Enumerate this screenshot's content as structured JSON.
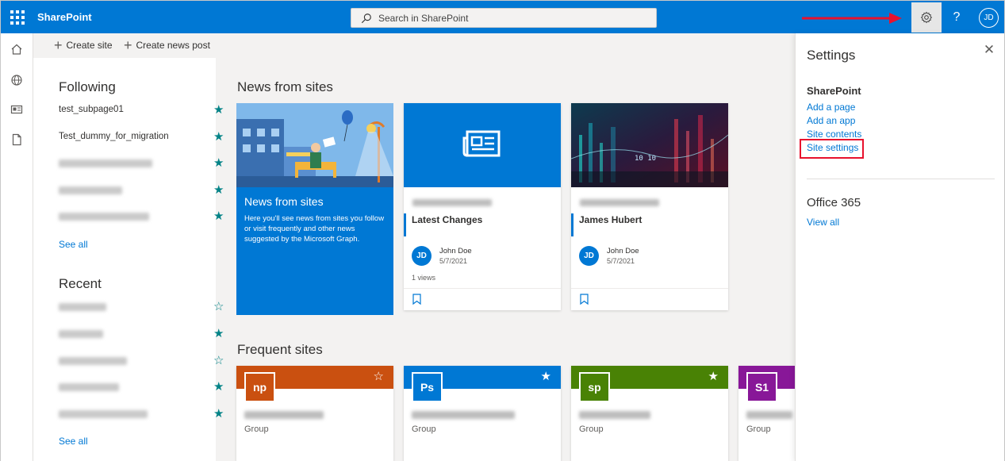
{
  "app": {
    "brand": "SharePoint",
    "search_placeholder": "Search in SharePoint",
    "avatar_initials": "JD",
    "help_label": "?"
  },
  "commandbar": {
    "create_site": "Create site",
    "create_news_post": "Create news post"
  },
  "left_panel": {
    "following_title": "Following",
    "following_items": [
      {
        "label": "test_subpage01",
        "starred": true
      },
      {
        "label": "Test_dummy_for_migration",
        "starred": true
      },
      {
        "label": "",
        "starred": true
      },
      {
        "label": "",
        "starred": true
      },
      {
        "label": "",
        "starred": true
      }
    ],
    "see_all": "See all",
    "recent_title": "Recent",
    "recent_items": [
      {
        "label": "",
        "starred": false
      },
      {
        "label": "",
        "starred": true
      },
      {
        "label": "",
        "starred": false
      },
      {
        "label": "",
        "starred": true
      },
      {
        "label": "",
        "starred": true
      }
    ],
    "star_filled": "★",
    "star_empty": "☆"
  },
  "news": {
    "section_title": "News from sites",
    "hero": {
      "title": "News from sites",
      "description": "Here you'll see news from sites you follow or visit frequently and other news suggested by the Microsoft Graph."
    },
    "cards": [
      {
        "title": "Latest Changes",
        "author": "John Doe",
        "initials": "JD",
        "date": "5/7/2021",
        "views": "1 views"
      },
      {
        "title": "James Hubert",
        "author": "John Doe",
        "initials": "JD",
        "date": "5/7/2021",
        "views": ""
      }
    ]
  },
  "frequent": {
    "section_title": "Frequent sites",
    "sites": [
      {
        "tile": "np",
        "color": "#ca5010",
        "type": "Group",
        "star": "☆"
      },
      {
        "tile": "Ps",
        "color": "#0078d4",
        "type": "Group",
        "star": "★"
      },
      {
        "tile": "sp",
        "color": "#498205",
        "type": "Group",
        "star": "★"
      },
      {
        "tile": "S1",
        "color": "#881798",
        "type": "Group",
        "star": ""
      }
    ]
  },
  "settings": {
    "title": "Settings",
    "sharepoint_heading": "SharePoint",
    "links": [
      "Add a page",
      "Add an app",
      "Site contents",
      "Site settings"
    ],
    "office_heading": "Office 365",
    "view_all": "View all"
  },
  "colors": {
    "brand_blue": "#0078d4",
    "star_teal": "#038387",
    "highlight_red": "#e8112d"
  }
}
